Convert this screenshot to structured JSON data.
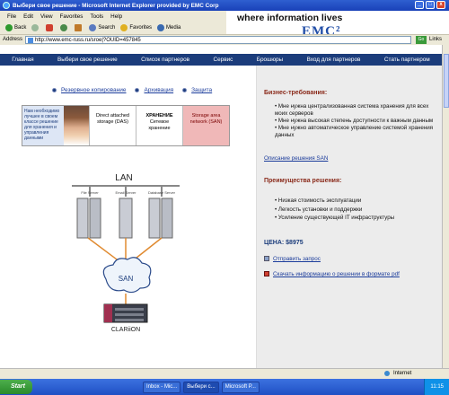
{
  "window": {
    "title": "Выбери свое решение - Microsoft Internet Explorer provided by EMC Corp",
    "min": "_",
    "max": "□",
    "close": "x"
  },
  "menu": [
    "File",
    "Edit",
    "View",
    "Favorites",
    "Tools",
    "Help"
  ],
  "banner": {
    "tagline": "where information lives",
    "logo": "EMC²"
  },
  "toolbar": {
    "back": "Back",
    "search": "Search",
    "favorites": "Favorites",
    "media": "Media"
  },
  "address": {
    "label": "Address",
    "url": "http://www.emc-russ.ru/sroe|?OUID=457845",
    "go": "Go",
    "links": "Links"
  },
  "nav": [
    "Главная",
    "Выбери свое решение",
    "Список партнеров",
    "Сервис",
    "Брошюры",
    "Вход для партнеров",
    "Стать партнером"
  ],
  "radios": [
    "Резервное копирование",
    "Архивация",
    "Защита"
  ],
  "strip": {
    "intro": "Нам необходимо лучшее в своем классе решение для хранения и управления данными",
    "das": "Direct attached storage (DAS)",
    "hraneniye_title": "ХРАНЕНИЕ",
    "hraneniye": "Сетевое хранение",
    "san": "Storage area network (SAN)"
  },
  "diagram": {
    "lan": "LAN",
    "servers": [
      "File Server",
      "Email Server",
      "Database Server"
    ],
    "san": "SAN",
    "storage": "CLARiiON"
  },
  "right": {
    "req_title": "Бизнес-требования:",
    "req_items": [
      "Мне нужна централизованная система хранения для всех моих серверов",
      "Мне нужна высокая степень доступности к важным данным",
      "Мне нужно автоматическое управление системой хранения данных"
    ],
    "san_link": "Описание решения SAN",
    "adv_title": "Преимущества решения:",
    "adv_items": [
      "Низкая стоимость эксплуатации",
      "Легкость установки и поддержки",
      "Усиление существующей IT инфраструктуры"
    ],
    "price": "ЦЕНА: $8975",
    "send_link": "Отправить запрос",
    "download_link": "Скачать информацию о решении в формате pdf"
  },
  "status": {
    "zone": "Internet"
  },
  "taskbar": {
    "start": "Start",
    "tasks": [
      "Inbox - Mic...",
      "Выбери с...",
      "Microsoft P..."
    ],
    "clock": "11:15"
  }
}
